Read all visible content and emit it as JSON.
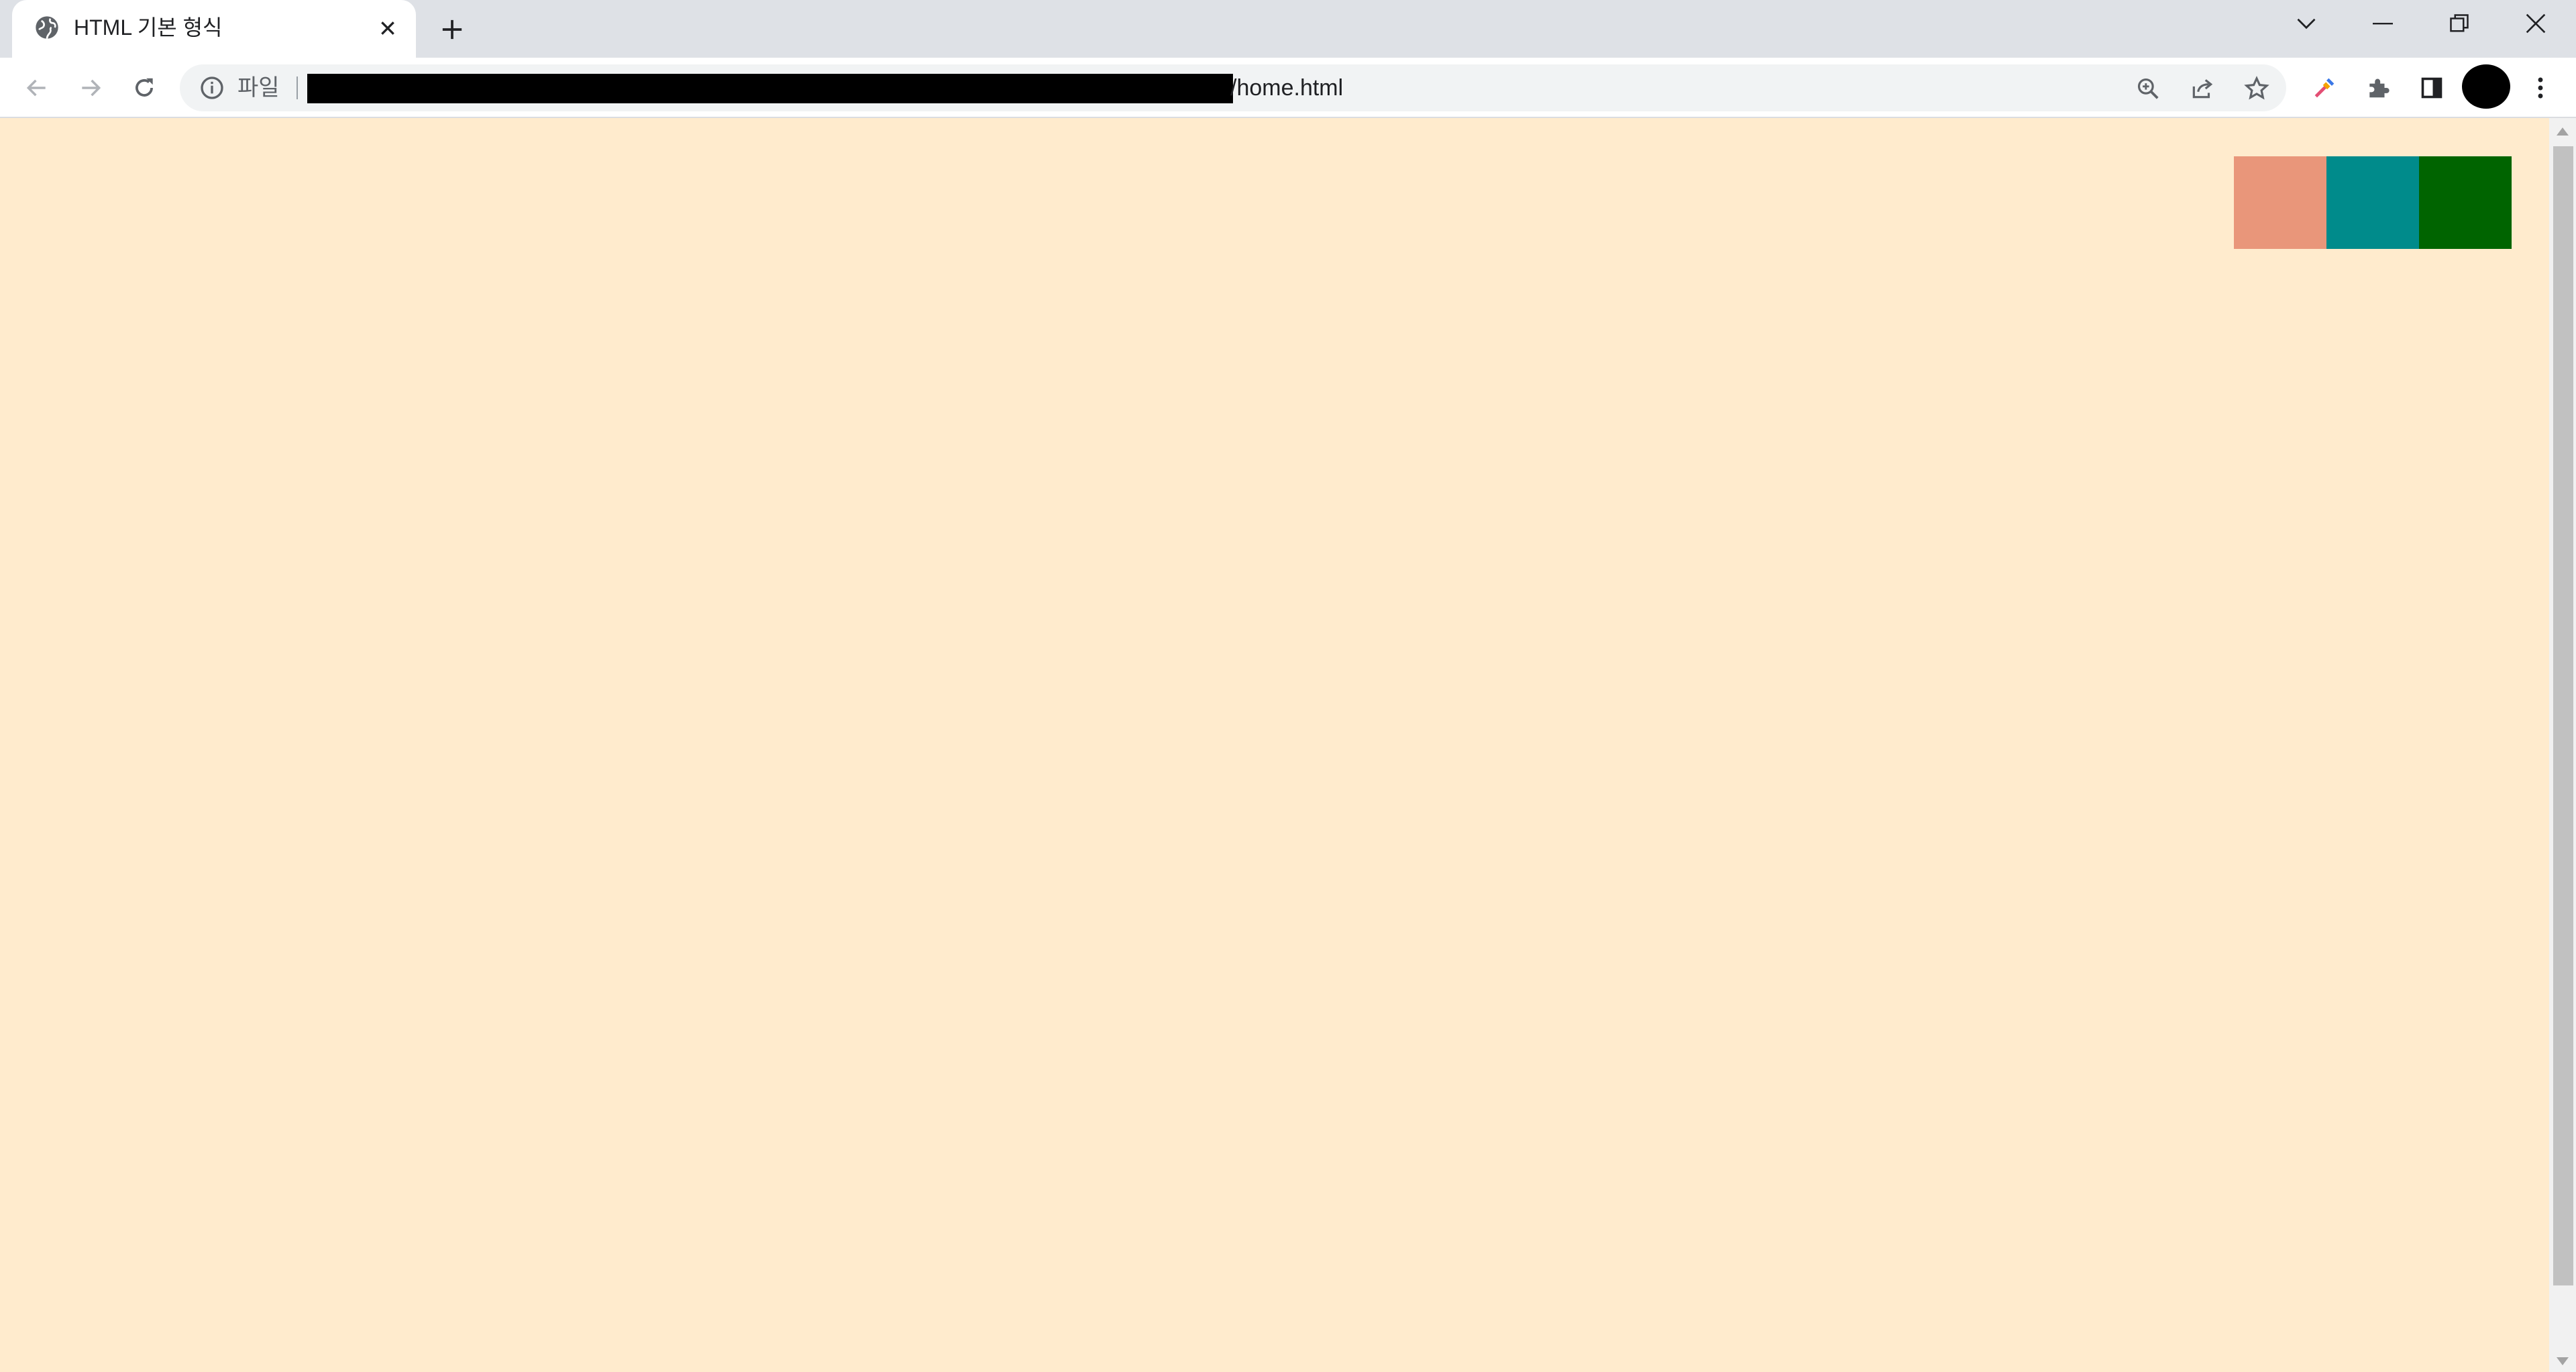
{
  "tab": {
    "title": "HTML 기본 형식",
    "favicon": "globe-icon"
  },
  "toolbar": {
    "scheme_label": "파일",
    "url_tail": "/home.html",
    "icons": [
      "back-icon",
      "forward-icon",
      "reload-icon",
      "site-info-icon",
      "zoom-icon",
      "share-icon",
      "bookmark-star-icon",
      "color-picker-extension-icon",
      "extensions-puzzle-icon",
      "side-panel-icon",
      "profile-avatar",
      "menu-kebab-icon"
    ]
  },
  "window_controls": [
    "tab-search-chevron-icon",
    "minimize-icon",
    "restore-icon",
    "close-window-icon"
  ],
  "page": {
    "background_color": "#ffebcd",
    "swatches": [
      {
        "name": "darksalmon",
        "color": "#e9967a"
      },
      {
        "name": "darkcyan",
        "color": "#008b8b"
      },
      {
        "name": "darkgreen",
        "color": "#006400"
      }
    ]
  }
}
